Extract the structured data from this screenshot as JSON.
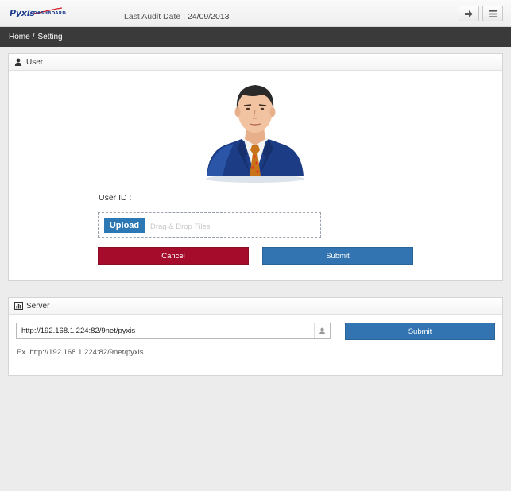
{
  "header": {
    "logo_text": "Pyxis",
    "logo_subtext": "DASHBOARD",
    "audit_label": "Last Audit Date : ",
    "audit_date": "24/09/2013",
    "logout_icon": "logout-icon",
    "menu_icon": "menu-icon"
  },
  "breadcrumb": {
    "home": "Home",
    "separator": "/",
    "current": "Setting"
  },
  "user_panel": {
    "title": "User",
    "icon": "user-icon",
    "user_id_label": "User ID :",
    "upload_label": "Upload",
    "drop_text": "Drag & Drop Files",
    "cancel_label": "Cancel",
    "submit_label": "Submit"
  },
  "server_panel": {
    "title": "Server",
    "icon": "bar-chart-icon",
    "url_value": "http://192.168.1.224:82/9net/pyxis",
    "input_icon": "user-icon",
    "submit_label": "Submit",
    "example_text": "Ex. http://192.168.1.224:82/9net/pyxis"
  },
  "colors": {
    "header_bar": "#3a3a3a",
    "cancel": "#a50c2b",
    "primary": "#3274b1",
    "upload": "#2b78b4"
  }
}
